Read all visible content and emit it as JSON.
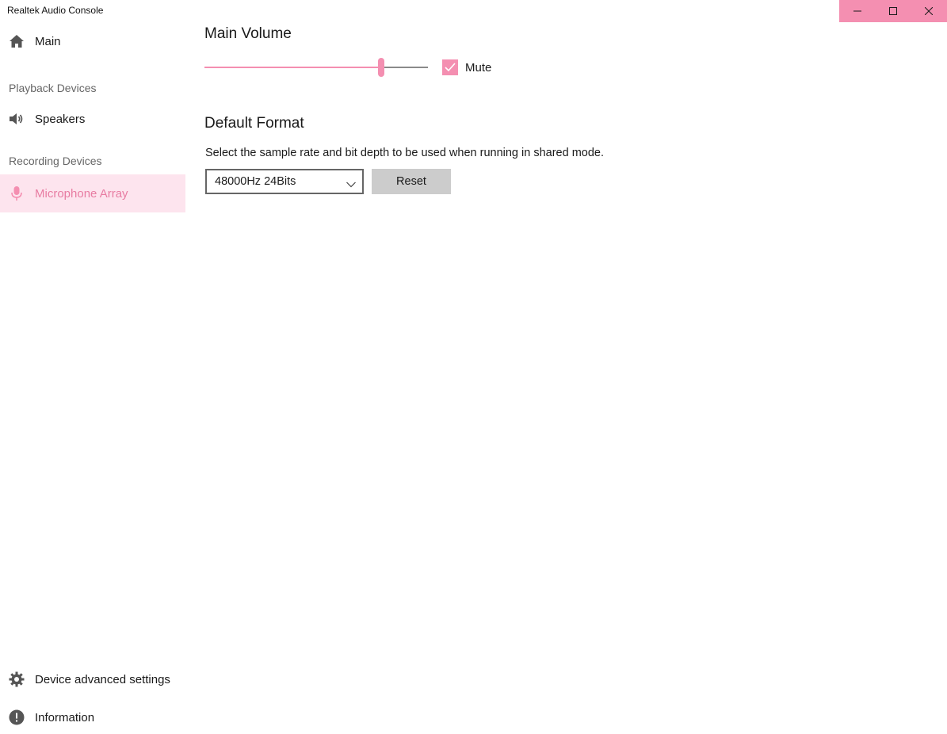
{
  "theme": {
    "accent_strong": "#f48fb1",
    "accent_soft": "#fde4ee",
    "accent_text": "#e87ca2"
  },
  "window": {
    "title": "Realtek Audio Console",
    "controls": [
      {
        "name": "minimize",
        "icon": "minimize-icon"
      },
      {
        "name": "maximize",
        "icon": "maximize-icon"
      },
      {
        "name": "close",
        "icon": "close-icon"
      }
    ]
  },
  "sidebar": {
    "main": {
      "label": "Main",
      "icon": "home-icon"
    },
    "playback_header": "Playback Devices",
    "speakers": {
      "label": "Speakers",
      "icon": "speaker-icon"
    },
    "recording_header": "Recording Devices",
    "microphone": {
      "label": "Microphone Array",
      "icon": "microphone-icon",
      "selected": true
    },
    "advanced": {
      "label": "Device advanced settings",
      "icon": "gear-icon"
    },
    "information": {
      "label": "Information",
      "icon": "info-icon"
    }
  },
  "main": {
    "volume": {
      "title": "Main Volume",
      "level_percent": 79,
      "mute_label": "Mute",
      "muted": true
    },
    "format": {
      "title": "Default Format",
      "description": "Select the sample rate and bit depth to be used when running in shared mode.",
      "selected": "48000Hz 24Bits",
      "reset_label": "Reset"
    }
  }
}
